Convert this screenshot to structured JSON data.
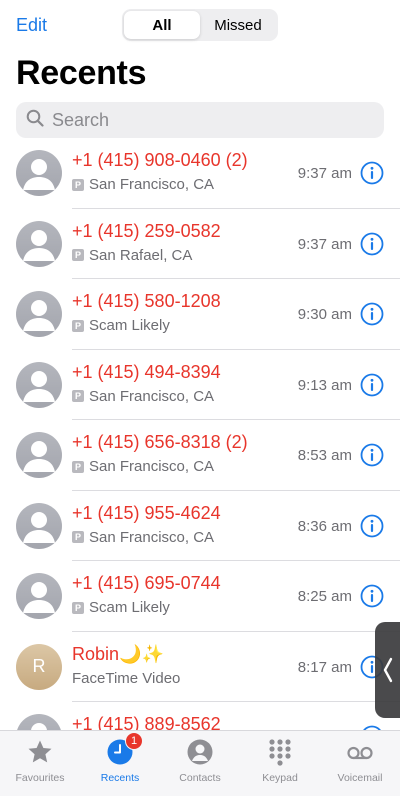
{
  "header": {
    "edit_label": "Edit",
    "segments": [
      "All",
      "Missed"
    ],
    "active_segment": "All",
    "title": "Recents"
  },
  "search": {
    "placeholder": "Search"
  },
  "calls": [
    {
      "name": "+1 (415) 908-0460 (2)",
      "subtitle": "San Francisco, CA",
      "badge": "P",
      "time": "9:37 am"
    },
    {
      "name": "+1 (415) 259-0582",
      "subtitle": "San Rafael, CA",
      "badge": "P",
      "time": "9:37 am"
    },
    {
      "name": "+1 (415) 580-1208",
      "subtitle": "Scam Likely",
      "badge": "P",
      "time": "9:30 am"
    },
    {
      "name": "+1 (415) 494-8394",
      "subtitle": "San Francisco, CA",
      "badge": "P",
      "time": "9:13 am"
    },
    {
      "name": "+1 (415) 656-8318 (2)",
      "subtitle": "San Francisco, CA",
      "badge": "P",
      "time": "8:53 am"
    },
    {
      "name": "+1 (415) 955-4624",
      "subtitle": "San Francisco, CA",
      "badge": "P",
      "time": "8:36 am"
    },
    {
      "name": "+1 (415) 695-0744",
      "subtitle": "Scam Likely",
      "badge": "P",
      "time": "8:25 am"
    },
    {
      "name": "Robin🌙✨",
      "subtitle": "FaceTime Video",
      "avatar_letter": "R",
      "time": "8:17 am"
    },
    {
      "name": "+1 (415) 889-8562",
      "subtitle": "",
      "badge": "",
      "time": ""
    }
  ],
  "tabs": [
    {
      "label": "Favourites",
      "icon": "star-icon"
    },
    {
      "label": "Recents",
      "icon": "clock-icon",
      "badge": "1",
      "active": true
    },
    {
      "label": "Contacts",
      "icon": "person-circle-icon"
    },
    {
      "label": "Keypad",
      "icon": "keypad-icon"
    },
    {
      "label": "Voicemail",
      "icon": "voicemail-icon"
    }
  ],
  "colors": {
    "accent": "#1a7ae8",
    "missed": "#e8352b",
    "secondary_text": "#6d6d72"
  }
}
